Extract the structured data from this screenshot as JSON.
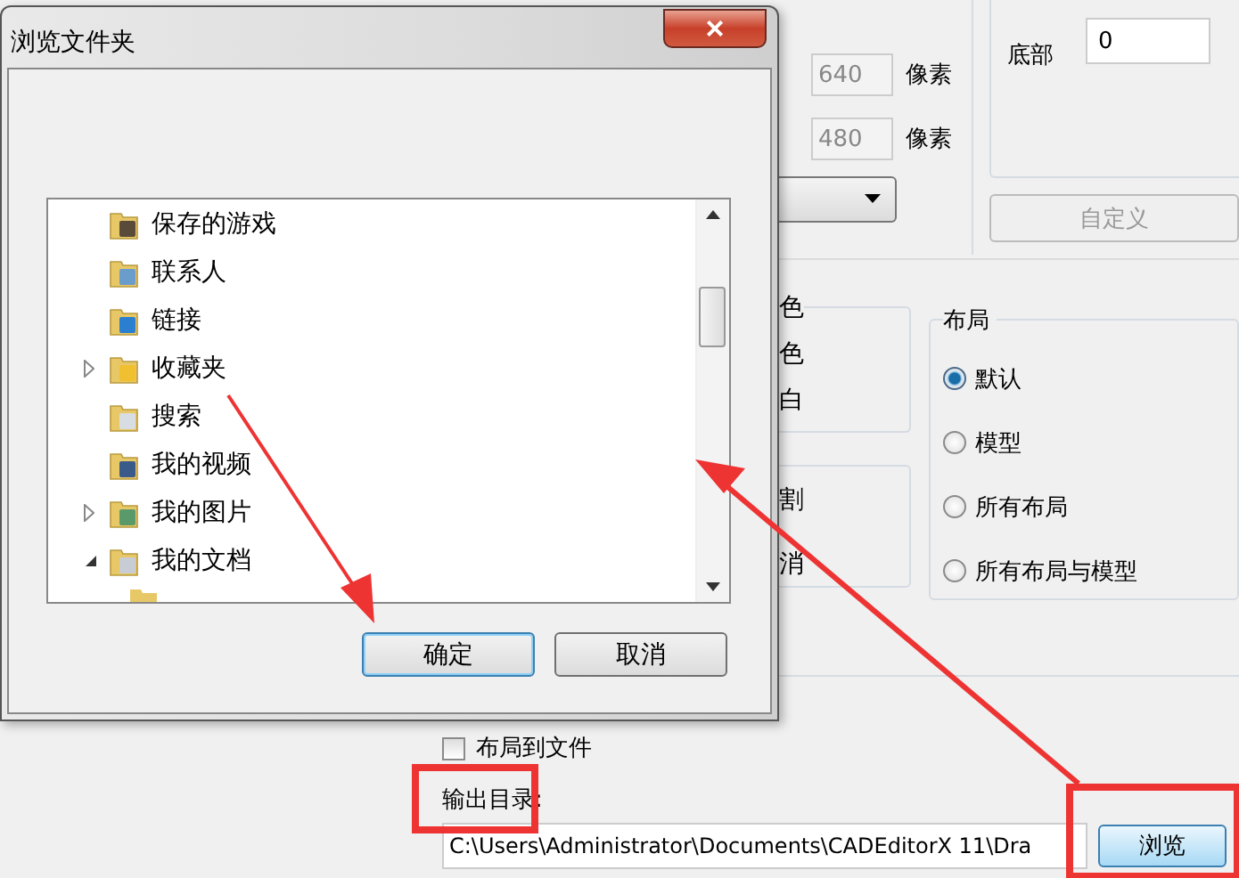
{
  "settings": {
    "size_fields": [
      {
        "value": "640",
        "unit": "像素",
        "disabled": true
      },
      {
        "value": "480",
        "unit": "像素",
        "disabled": true
      }
    ],
    "bottom_label": "底部",
    "bottom_value": "0",
    "custom_button": {
      "label": "自定义",
      "disabled": true
    },
    "color_group_fragments": [
      "色",
      "色",
      "白"
    ],
    "other_group_fragments": [
      "割",
      "消"
    ],
    "layout_group": {
      "title": "布局",
      "options": [
        {
          "label": "默认",
          "selected": true
        },
        {
          "label": "模型",
          "selected": false
        },
        {
          "label": "所有布局",
          "selected": false
        },
        {
          "label": "所有布局与模型",
          "selected": false
        }
      ]
    },
    "layout_to_file": {
      "label": "布局到文件",
      "checked": false
    },
    "output_dir_label": "输出目录:",
    "output_dir_value": "C:\\Users\\Administrator\\Documents\\CADEditorX 11\\Dra",
    "browse_button": "浏览"
  },
  "dialog": {
    "title": "浏览文件夹",
    "close": "×",
    "tree": [
      {
        "label": "保存的游戏",
        "kind": "games",
        "expandable": false
      },
      {
        "label": "联系人",
        "kind": "contacts",
        "expandable": false
      },
      {
        "label": "链接",
        "kind": "links",
        "expandable": false
      },
      {
        "label": "收藏夹",
        "kind": "favorites",
        "expandable": true,
        "expanded": false
      },
      {
        "label": "搜索",
        "kind": "search",
        "expandable": false
      },
      {
        "label": "我的视频",
        "kind": "videos",
        "expandable": false
      },
      {
        "label": "我的图片",
        "kind": "pictures",
        "expandable": true,
        "expanded": false
      },
      {
        "label": "我的文档",
        "kind": "documents",
        "expandable": true,
        "expanded": true
      }
    ],
    "buttons": [
      {
        "label": "确定",
        "default": true
      },
      {
        "label": "取消",
        "default": false
      }
    ]
  }
}
